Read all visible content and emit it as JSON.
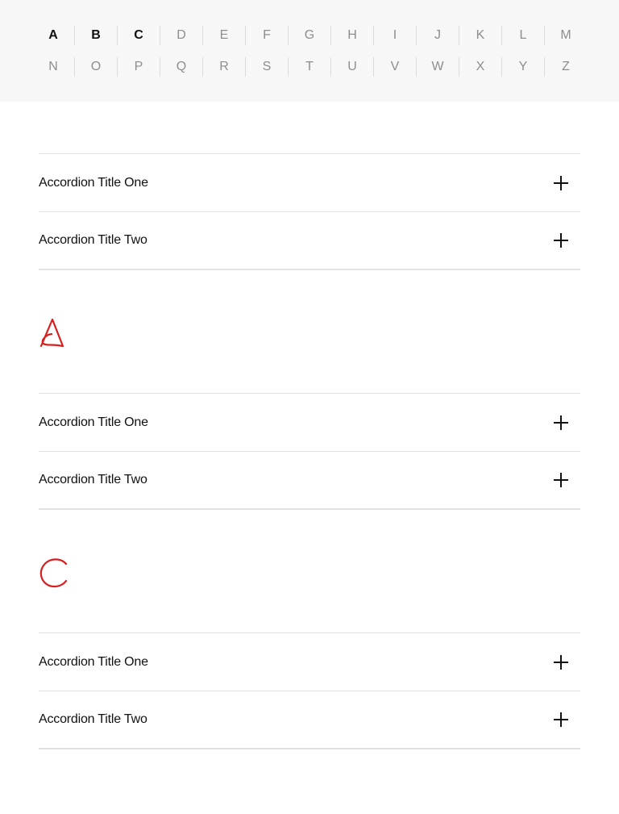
{
  "alphabet_nav": {
    "row1": [
      "A",
      "B",
      "C",
      "D",
      "E",
      "F",
      "G",
      "H",
      "I",
      "J",
      "K",
      "L",
      "M"
    ],
    "row2": [
      "N",
      "O",
      "P",
      "Q",
      "R",
      "S",
      "T",
      "U",
      "V",
      "W",
      "X",
      "Y",
      "Z"
    ],
    "active_letters": [
      "A",
      "B",
      "C"
    ]
  },
  "colors": {
    "accent": "#d71f1f",
    "text": "#111111",
    "muted_letter": "#8e8e8e",
    "nav_background": "#f7f7f7",
    "divider": "#e2e2e2"
  },
  "sections": [
    {
      "letter": "",
      "items": [
        {
          "title": "Accordion Title One",
          "icon": "plus-icon"
        },
        {
          "title": "Accordion Title Two",
          "icon": "plus-icon"
        }
      ]
    },
    {
      "letter": "A",
      "letter_icon": "letter-a-icon",
      "items": [
        {
          "title": "Accordion Title One",
          "icon": "plus-icon"
        },
        {
          "title": "Accordion Title Two",
          "icon": "plus-icon"
        }
      ]
    },
    {
      "letter": "C",
      "letter_icon": "letter-c-icon",
      "items": [
        {
          "title": "Accordion Title One",
          "icon": "plus-icon"
        },
        {
          "title": "Accordion Title Two",
          "icon": "plus-icon"
        }
      ]
    }
  ]
}
